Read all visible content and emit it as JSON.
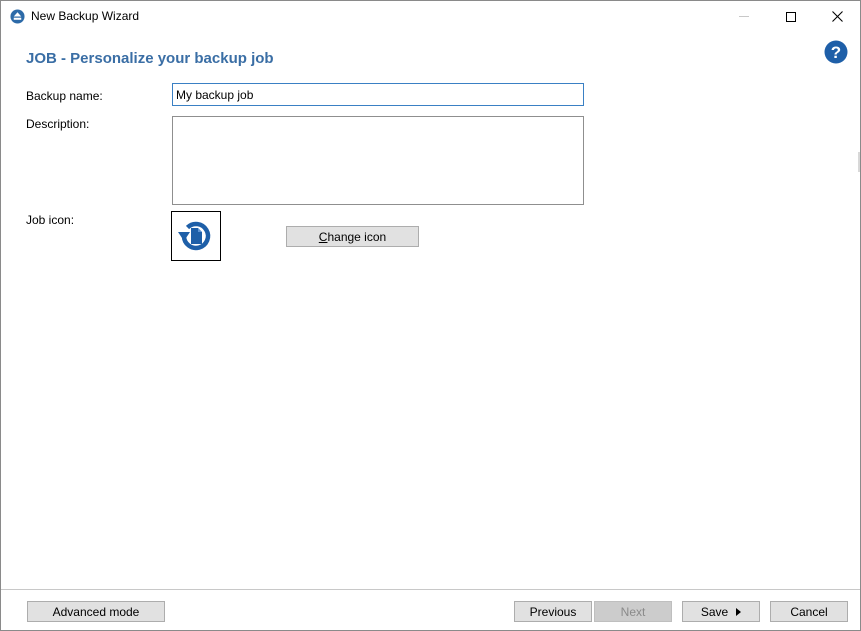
{
  "window": {
    "title": "New Backup Wizard",
    "app_icon": "eject-circle-icon",
    "accent_color": "#3a6ea5"
  },
  "page": {
    "title": "JOB - Personalize your backup job"
  },
  "form": {
    "backup_name_label": "Backup name:",
    "backup_name_value": "My backup job",
    "description_label": "Description:",
    "description_value": "",
    "job_icon_label": "Job icon:",
    "job_icon": "backup-document-icon",
    "change_icon_prefix": "",
    "change_icon_mnemonic": "C",
    "change_icon_rest": "hange icon"
  },
  "footer": {
    "advanced_mode": "Advanced mode",
    "previous": "Previous",
    "next": "Next",
    "save": "Save",
    "cancel": "Cancel"
  }
}
